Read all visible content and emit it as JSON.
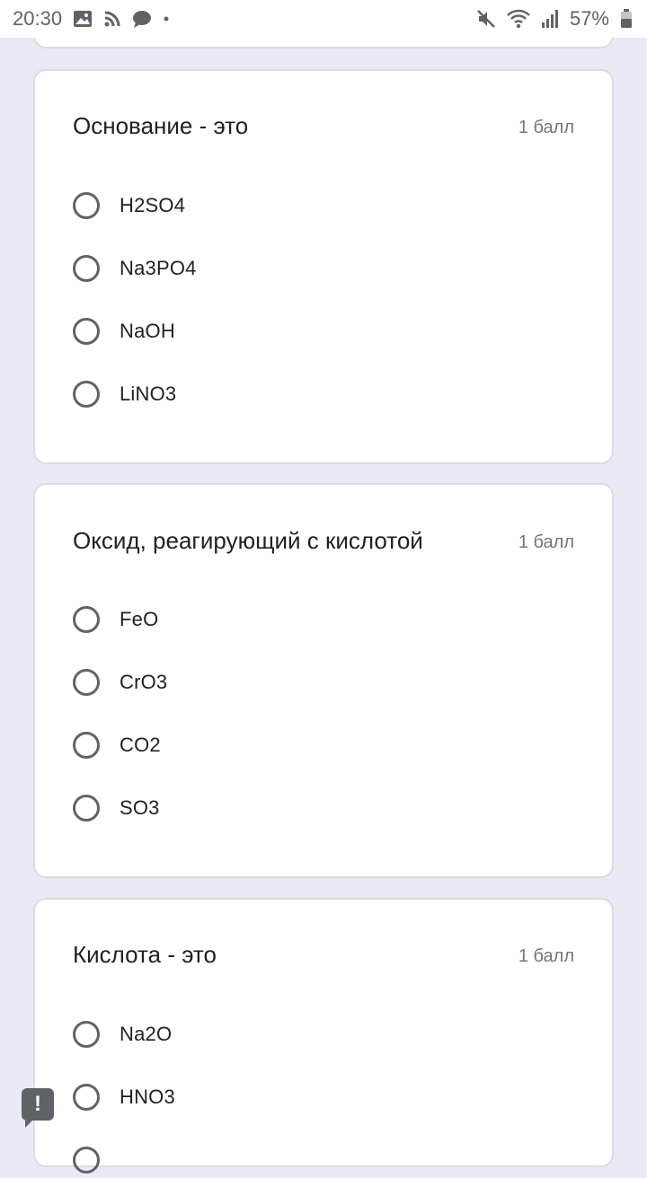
{
  "status_bar": {
    "time": "20:30",
    "battery": "57%"
  },
  "questions": [
    {
      "title": "Основание - это",
      "points": "1 балл",
      "options": [
        "H2SO4",
        "Na3PO4",
        "NaOH",
        "LiNO3"
      ]
    },
    {
      "title": "Оксид, реагирующий с кислотой",
      "points": "1 балл",
      "options": [
        "FeO",
        "CrO3",
        "CO2",
        "SO3"
      ]
    },
    {
      "title": "Кислота - это",
      "points": "1 балл",
      "options": [
        "Na2O",
        "HNO3"
      ]
    }
  ],
  "icons": {
    "gallery": "gallery-icon",
    "rss": "rss-icon",
    "chat": "chat-icon",
    "mute": "mute-icon",
    "wifi": "wifi-icon",
    "signal": "signal-icon",
    "battery": "battery-icon",
    "report": "report-icon"
  },
  "colors": {
    "background": "#ece9f7",
    "card": "#ffffff",
    "radio": "#5f6368"
  }
}
